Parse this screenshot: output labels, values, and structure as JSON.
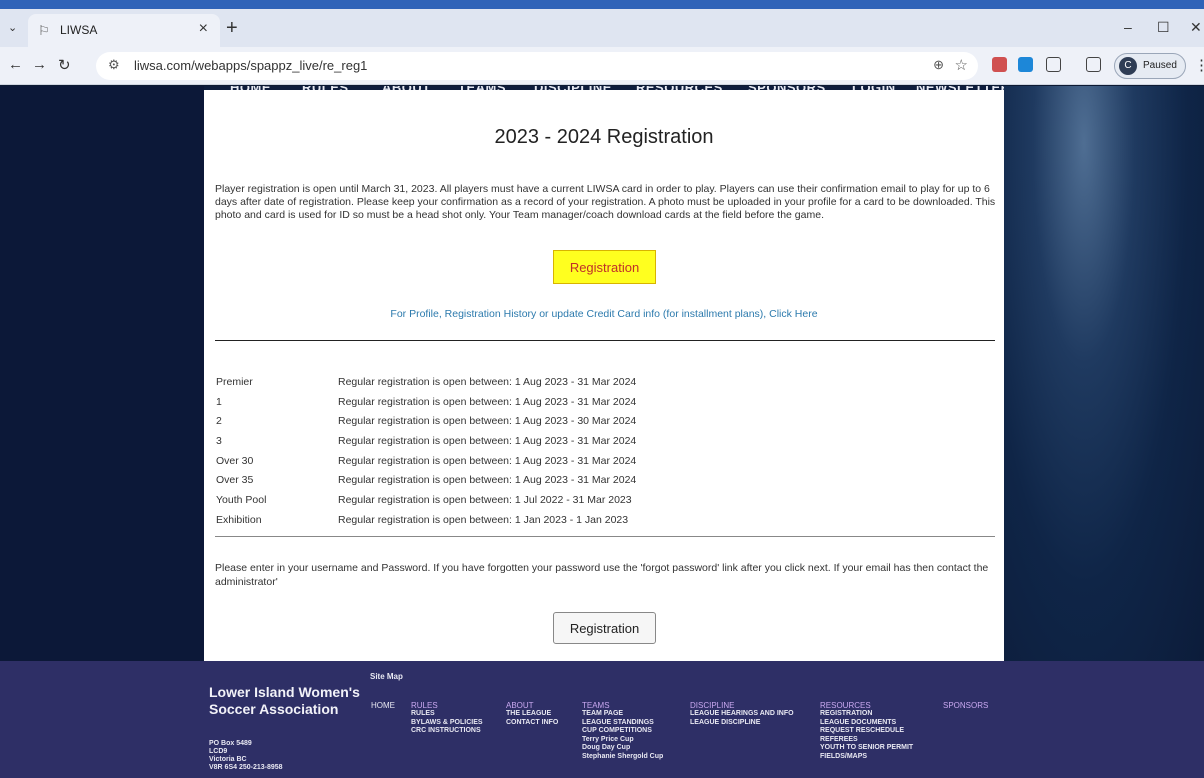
{
  "browser": {
    "tab_title": "LIWSA",
    "url": "liwsa.com/webapps/spappz_live/re_reg1",
    "profile_status": "Paused",
    "profile_initial": "C"
  },
  "nav": [
    "HOME",
    "RULES",
    "ABOUT",
    "TEAMS",
    "DISCIPLINE",
    "RESOURCES",
    "SPONSORS",
    "LOGIN",
    "NEWSLETTER"
  ],
  "page": {
    "title": "2023 - 2024 Registration",
    "intro": "Player registration is open until March 31, 2023. All players must have a current LIWSA card in order to play. Players can use their confirmation email to play for up to 6 days after date of registration. Please keep your confirmation as a record of your registration. A photo must be uploaded in your profile for a card to be downloaded. This photo and card is used for ID so must be a head shot only. Your Team manager/coach download cards at the field before the game.",
    "registration_button": "Registration",
    "profile_link": "For Profile, Registration History or update Credit Card info (for installment plans), Click Here",
    "divisions": [
      {
        "name": "Premier",
        "text": "Regular registration is open between: 1 Aug 2023 - 31 Mar 2024"
      },
      {
        "name": "1",
        "text": "Regular registration is open between: 1 Aug 2023 - 31 Mar 2024"
      },
      {
        "name": "2",
        "text": "Regular registration is open between: 1 Aug 2023 - 30 Mar 2024"
      },
      {
        "name": "3",
        "text": "Regular registration is open between: 1 Aug 2023 - 31 Mar 2024"
      },
      {
        "name": "Over 30",
        "text": "Regular registration is open between: 1 Aug 2023 - 31 Mar 2024"
      },
      {
        "name": "Over 35",
        "text": "Regular registration is open between: 1 Aug 2023 - 31 Mar 2024"
      },
      {
        "name": "Youth Pool",
        "text": "Regular registration is open between: 1 Jul 2022 - 31 Mar 2023"
      },
      {
        "name": "Exhibition",
        "text": "Regular registration is open between: 1 Jan 2023 - 1 Jan 2023"
      }
    ],
    "login_note": "Please enter in your username and Password. If you have forgotten your password use the 'forgot password' link after you click next. If your email has then contact the administrator'",
    "registration_button_2": "Registration"
  },
  "footer": {
    "sitemap_label": "Site Map",
    "org_name": "Lower Island Women's Soccer Association",
    "address": [
      "PO Box 5489",
      "LCD9",
      "Victoria BC",
      "V8R 6S4 250-213-8958"
    ],
    "columns": [
      {
        "head": "HOME",
        "items": []
      },
      {
        "head": "RULES",
        "items": [
          "RULES",
          "BYLAWS & POLICIES",
          "CRC INSTRUCTIONS"
        ]
      },
      {
        "head": "ABOUT",
        "items": [
          "THE LEAGUE",
          "CONTACT INFO"
        ]
      },
      {
        "head": "TEAMS",
        "items": [
          "TEAM PAGE",
          "LEAGUE STANDINGS",
          "CUP COMPETITIONS",
          "Terry Price Cup",
          "Doug Day Cup",
          "Stephanie Shergold Cup"
        ]
      },
      {
        "head": "DISCIPLINE",
        "items": [
          "LEAGUE HEARINGS AND INFO",
          "LEAGUE DISCIPLINE"
        ]
      },
      {
        "head": "RESOURCES",
        "items": [
          "REGISTRATION",
          "LEAGUE DOCUMENTS",
          "REQUEST RESCHEDULE",
          "REFEREES",
          "YOUTH TO SENIOR PERMIT",
          "FIELDS/MAPS"
        ]
      },
      {
        "head": "SPONSORS",
        "items": []
      }
    ]
  },
  "colors": {
    "accent_link": "#2c7aad",
    "highlight_button": "#ffff1f",
    "footer_bg": "#2e2f66",
    "page_bg": "#0e1d3d"
  }
}
